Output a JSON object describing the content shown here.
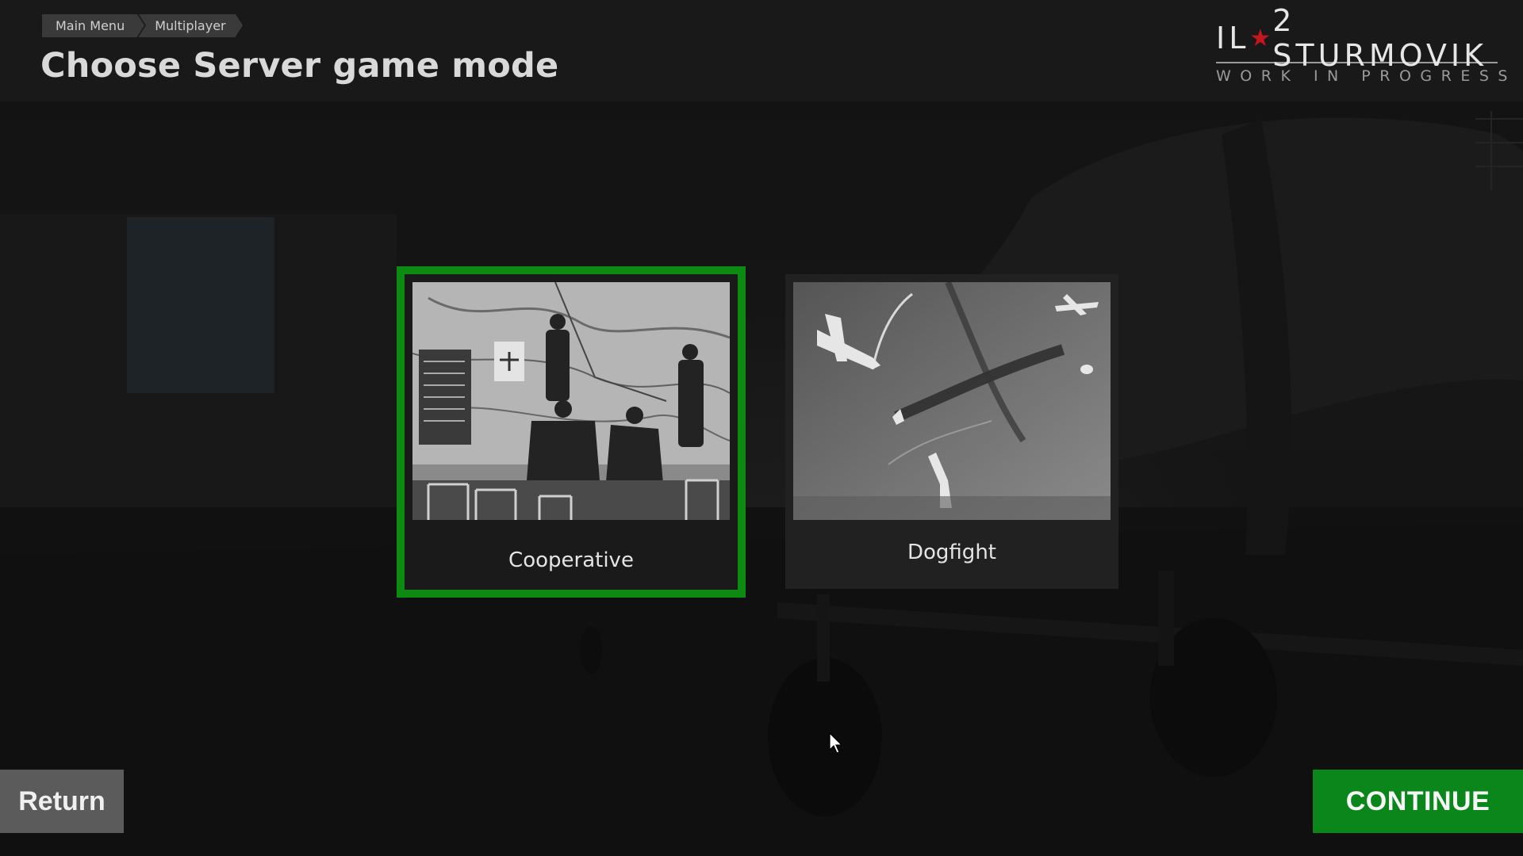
{
  "breadcrumb": {
    "items": [
      "Main Menu",
      "Multiplayer"
    ]
  },
  "page": {
    "title": "Choose Server game mode"
  },
  "logo": {
    "left": "IL",
    "right": "2 STURMOVIK",
    "subtitle": "WORK IN PROGRESS",
    "star_color": "#c4161c"
  },
  "modes": [
    {
      "label": "Cooperative",
      "selected": true
    },
    {
      "label": "Dogfight",
      "selected": false
    }
  ],
  "buttons": {
    "return_label": "Return",
    "continue_label": "CONTINUE"
  },
  "colors": {
    "accent_green": "#0d8a12",
    "continue_green": "#0a861a",
    "return_gray": "#5b5b5b"
  }
}
